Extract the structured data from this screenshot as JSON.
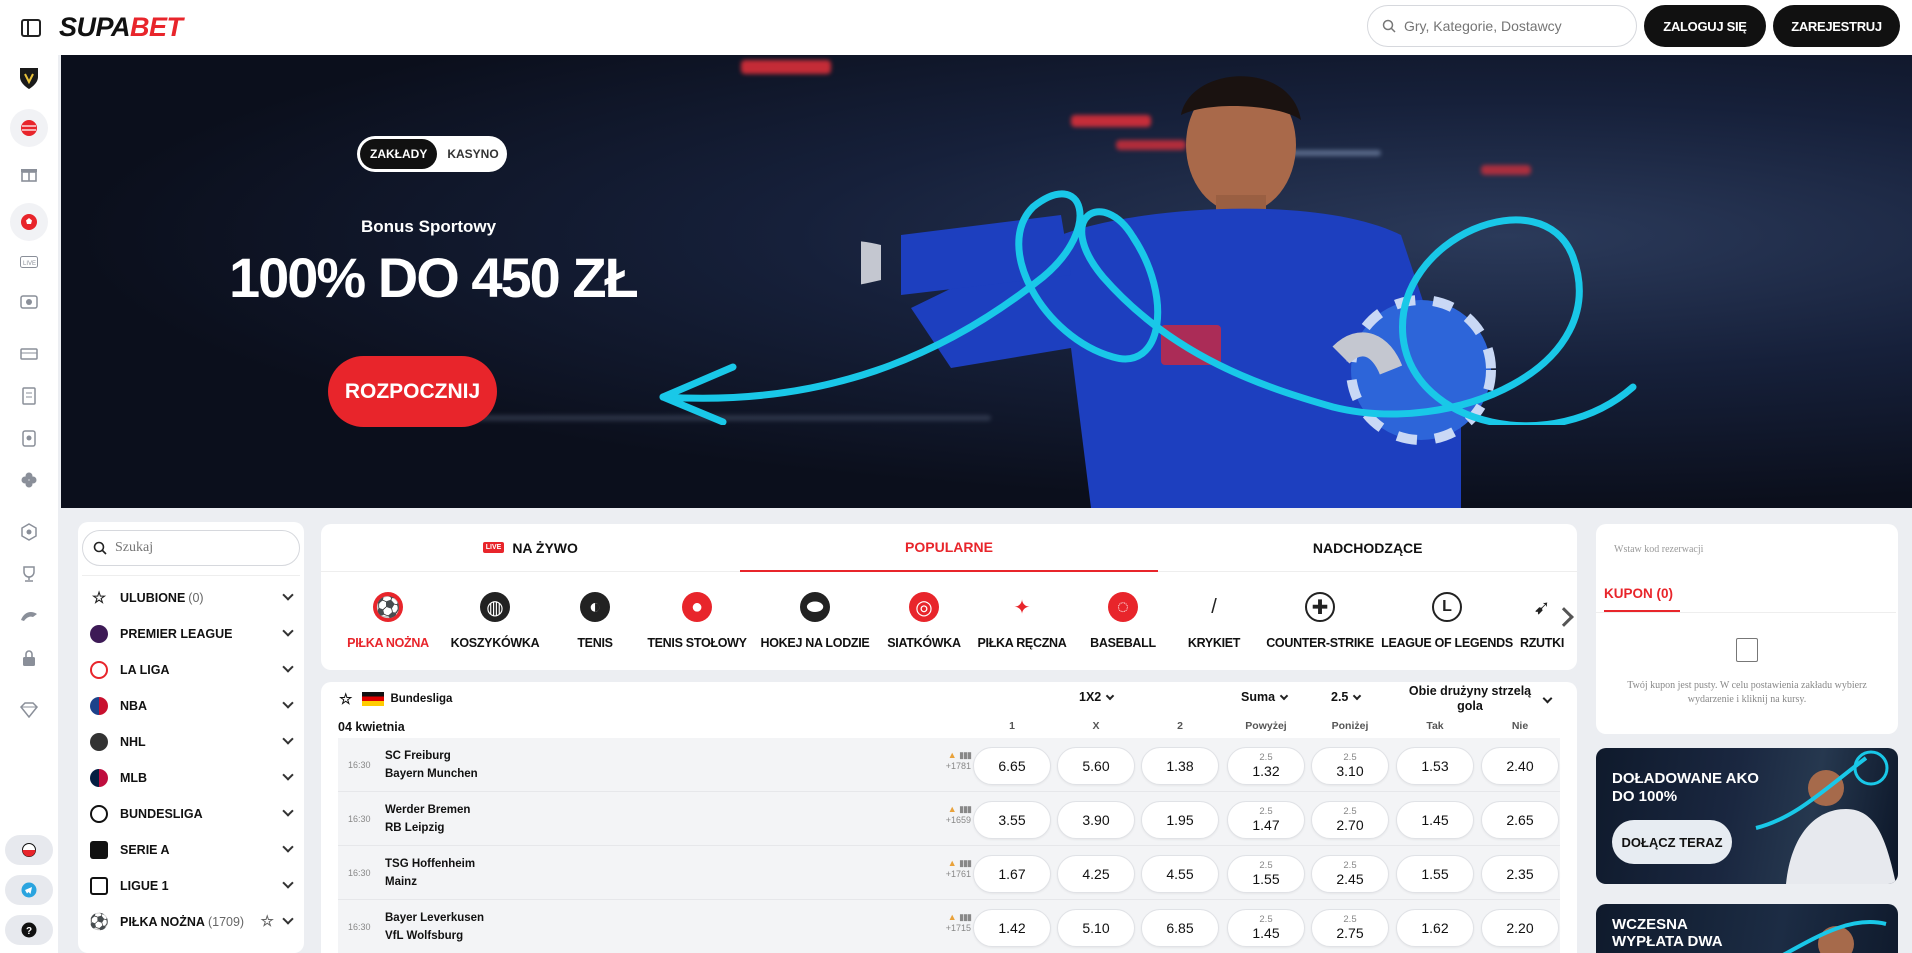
{
  "header": {
    "logo_a": "SUPA",
    "logo_b": "BET",
    "search_placeholder": "Gry, Kategorie, Dostawcy",
    "login": "ZALOGUJ SIĘ",
    "register": "ZAREJESTRUJ"
  },
  "hero": {
    "toggle_on": "ZAKŁADY",
    "toggle_off": "KASYNO",
    "subtitle": "Bonus Sportowy",
    "headline": "100% DO 450 ZŁ",
    "cta": "ROZPOCZNIJ"
  },
  "leftnav": {
    "search_placeholder": "Szukaj",
    "items": [
      {
        "label": "ULUBIONE",
        "count": "(0)"
      },
      {
        "label": "PREMIER LEAGUE"
      },
      {
        "label": "LA LIGA"
      },
      {
        "label": "NBA"
      },
      {
        "label": "NHL"
      },
      {
        "label": "MLB"
      },
      {
        "label": "BUNDESLIGA"
      },
      {
        "label": "SERIE A"
      },
      {
        "label": "LIGUE 1"
      },
      {
        "label": "PIŁKA NOŻNA",
        "count": "(1709)"
      }
    ]
  },
  "tabs": {
    "live_badge": "LIVE",
    "live": "NA ŻYWO",
    "popular": "POPULARNE",
    "upcoming": "NADCHODZĄCE"
  },
  "sports": [
    {
      "label": "PIŁKA NOŻNA"
    },
    {
      "label": "KOSZYKÓWKA"
    },
    {
      "label": "TENIS"
    },
    {
      "label": "TENIS STOŁOWY"
    },
    {
      "label": "HOKEJ NA LODZIE"
    },
    {
      "label": "SIATKÓWKA"
    },
    {
      "label": "PIŁKA RĘCZNA"
    },
    {
      "label": "BASEBALL"
    },
    {
      "label": "KRYKIET"
    },
    {
      "label": "COUNTER-STRIKE"
    },
    {
      "label": "LEAGUE OF LEGENDS"
    },
    {
      "label": "RZUTKI"
    }
  ],
  "league": {
    "name": "Bundesliga",
    "market1": "1X2",
    "market2": "Suma",
    "market2_line": "2.5",
    "market3": "Obie drużyny strzelą gola",
    "date": "04 kwietnia",
    "cols": [
      "1",
      "X",
      "2",
      "Powyżej",
      "Poniżej",
      "Tak",
      "Nie"
    ]
  },
  "matches": [
    {
      "time": "16:30",
      "home": "SC Freiburg",
      "away": "Bayern Munchen",
      "more": "+1781",
      "o1": "6.65",
      "ox": "5.60",
      "o2": "1.38",
      "line": "2.5",
      "over": "1.32",
      "under": "3.10",
      "yes": "1.53",
      "no": "2.40"
    },
    {
      "time": "16:30",
      "home": "Werder Bremen",
      "away": "RB Leipzig",
      "more": "+1659",
      "o1": "3.55",
      "ox": "3.90",
      "o2": "1.95",
      "line": "2.5",
      "over": "1.47",
      "under": "2.70",
      "yes": "1.45",
      "no": "2.65"
    },
    {
      "time": "16:30",
      "home": "TSG Hoffenheim",
      "away": "Mainz",
      "more": "+1761",
      "o1": "1.67",
      "ox": "4.25",
      "o2": "4.55",
      "line": "2.5",
      "over": "1.55",
      "under": "2.45",
      "yes": "1.55",
      "no": "2.35"
    },
    {
      "time": "16:30",
      "home": "Bayer Leverkusen",
      "away": "VfL Wolfsburg",
      "more": "+1715",
      "o1": "1.42",
      "ox": "5.10",
      "o2": "6.85",
      "line": "2.5",
      "over": "1.45",
      "under": "2.75",
      "yes": "1.62",
      "no": "2.20"
    }
  ],
  "coupon": {
    "code_placeholder": "Wstaw kod rezerwacji",
    "title": "KUPON (0)",
    "empty_msg": "Twój kupon jest pusty. W celu postawienia zakładu wybierz wydarzenie i kliknij na kursy."
  },
  "promos": [
    {
      "title": "DOŁADOWANE AKO DO 100%",
      "button": "DOŁĄCZ TERAZ"
    },
    {
      "title": "WCZESNA WYPŁATA DWA GOLE"
    }
  ],
  "colors": {
    "accent": "#e8252b",
    "dark": "#111111",
    "cyan": "#19c8e8"
  }
}
